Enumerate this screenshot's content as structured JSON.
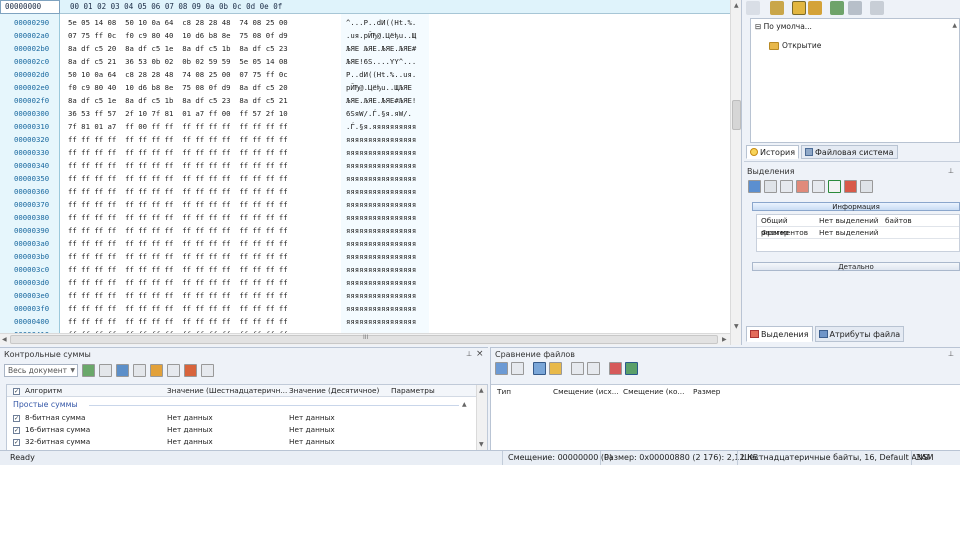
{
  "hex": {
    "offset_header": "00000000",
    "column_header": "00 01 02 03  04 05 06 07  08 09 0a 0b  0c 0d 0e 0f",
    "rows": [
      {
        "addr": "00000290",
        "bytes": "5e 05 14 08  50 10 0a 64  c8 28 28 48  74 08 25 00",
        "ascii": "^...P..dИ((Ht.%."
      },
      {
        "addr": "000002a0",
        "bytes": "07 75 ff 0c  f0 c9 80 40  10 d6 b8 8e  75 08 0f d9",
        "ascii": ".uя.рЙЂ@.Цёђu..Щ"
      },
      {
        "addr": "000002b0",
        "bytes": "8a df c5 20  8a df c5 1e  8a df c5 1b  8a df c5 23",
        "ascii": "ЉЯЕ ЉЯЕ.ЉЯЕ.ЉЯЕ#"
      },
      {
        "addr": "000002c0",
        "bytes": "8a df c5 21  36 53 0b 02  0b 02 59 59  5e 05 14 08",
        "ascii": "ЉЯЕ!6S....YY^..."
      },
      {
        "addr": "000002d0",
        "bytes": "50 10 0a 64  c8 28 28 48  74 08 25 00  07 75 ff 0c",
        "ascii": "P..dИ((Ht.%..uя."
      },
      {
        "addr": "000002e0",
        "bytes": "f0 c9 80 40  10 d6 b8 8e  75 08 0f d9  8a df c5 20",
        "ascii": "рЙЂ@.Цёђu..ЩЉЯЕ "
      },
      {
        "addr": "000002f0",
        "bytes": "8a df c5 1e  8a df c5 1b  8a df c5 23  8a df c5 21",
        "ascii": "ЉЯЕ.ЉЯЕ.ЉЯЕ#ЉЯЕ!"
      },
      {
        "addr": "00000300",
        "bytes": "36 53 ff 57  2f 10 7f 81  01 a7 ff 00  ff 57 2f 10",
        "ascii": "6SяW/.Ѓ.§я.яW/."
      },
      {
        "addr": "00000310",
        "bytes": "7f 81 01 a7  ff 00 ff ff  ff ff ff ff  ff ff ff ff",
        "ascii": ".Ѓ.§я.яяяяяяяяяя"
      },
      {
        "addr": "00000320",
        "bytes": "ff ff ff ff  ff ff ff ff  ff ff ff ff  ff ff ff ff",
        "ascii": "яяяяяяяяяяяяяяяя"
      },
      {
        "addr": "00000330",
        "bytes": "ff ff ff ff  ff ff ff ff  ff ff ff ff  ff ff ff ff",
        "ascii": "яяяяяяяяяяяяяяяя"
      },
      {
        "addr": "00000340",
        "bytes": "ff ff ff ff  ff ff ff ff  ff ff ff ff  ff ff ff ff",
        "ascii": "яяяяяяяяяяяяяяяя"
      },
      {
        "addr": "00000350",
        "bytes": "ff ff ff ff  ff ff ff ff  ff ff ff ff  ff ff ff ff",
        "ascii": "яяяяяяяяяяяяяяяя"
      },
      {
        "addr": "00000360",
        "bytes": "ff ff ff ff  ff ff ff ff  ff ff ff ff  ff ff ff ff",
        "ascii": "яяяяяяяяяяяяяяяя"
      },
      {
        "addr": "00000370",
        "bytes": "ff ff ff ff  ff ff ff ff  ff ff ff ff  ff ff ff ff",
        "ascii": "яяяяяяяяяяяяяяяя"
      },
      {
        "addr": "00000380",
        "bytes": "ff ff ff ff  ff ff ff ff  ff ff ff ff  ff ff ff ff",
        "ascii": "яяяяяяяяяяяяяяяя"
      },
      {
        "addr": "00000390",
        "bytes": "ff ff ff ff  ff ff ff ff  ff ff ff ff  ff ff ff ff",
        "ascii": "яяяяяяяяяяяяяяяя"
      },
      {
        "addr": "000003a0",
        "bytes": "ff ff ff ff  ff ff ff ff  ff ff ff ff  ff ff ff ff",
        "ascii": "яяяяяяяяяяяяяяяя"
      },
      {
        "addr": "000003b0",
        "bytes": "ff ff ff ff  ff ff ff ff  ff ff ff ff  ff ff ff ff",
        "ascii": "яяяяяяяяяяяяяяяя"
      },
      {
        "addr": "000003c0",
        "bytes": "ff ff ff ff  ff ff ff ff  ff ff ff ff  ff ff ff ff",
        "ascii": "яяяяяяяяяяяяяяяя"
      },
      {
        "addr": "000003d0",
        "bytes": "ff ff ff ff  ff ff ff ff  ff ff ff ff  ff ff ff ff",
        "ascii": "яяяяяяяяяяяяяяяя"
      },
      {
        "addr": "000003e0",
        "bytes": "ff ff ff ff  ff ff ff ff  ff ff ff ff  ff ff ff ff",
        "ascii": "яяяяяяяяяяяяяяяя"
      },
      {
        "addr": "000003f0",
        "bytes": "ff ff ff ff  ff ff ff ff  ff ff ff ff  ff ff ff ff",
        "ascii": "яяяяяяяяяяяяяяяя"
      },
      {
        "addr": "00000400",
        "bytes": "ff ff ff ff  ff ff ff ff  ff ff ff ff  ff ff ff ff",
        "ascii": "яяяяяяяяяяяяяяяя"
      },
      {
        "addr": "00000410",
        "bytes": "ff ff ff ff  ff ff ff ff  ff ff ff ff  ff ff ff ff",
        "ascii": "яяяяяяяяяяяяяяяя"
      }
    ]
  },
  "history": {
    "root_label": "По умолча...",
    "item_label": "Открытие"
  },
  "right_tabs": {
    "history": "История",
    "filesystem": "Файловая система"
  },
  "selection": {
    "title": "Выделения",
    "info_label": "Информация",
    "rows": [
      {
        "name": "Общий размер",
        "value": "Нет выделений",
        "unit": "байтов"
      },
      {
        "name": "Фрагментов",
        "value": "Нет выделений",
        "unit": ""
      }
    ],
    "detail_label": "Детально"
  },
  "bottom_right_tabs": {
    "selections": "Выделения",
    "file_attrs": "Атрибуты файла"
  },
  "checksum": {
    "title": "Контрольные суммы",
    "scope": "Весь документ",
    "columns": {
      "algorithm": "Алгоритм",
      "hex": "Значение (Шестнадцатеричн...",
      "dec": "Значение (Десятичное)",
      "params": "Параметры"
    },
    "group": "Простые суммы",
    "rows": [
      {
        "name": "8-битная сумма",
        "hex": "Нет данных",
        "dec": "Нет данных"
      },
      {
        "name": "16-битная сумма",
        "hex": "Нет данных",
        "dec": "Нет данных"
      },
      {
        "name": "32-битная сумма",
        "hex": "Нет данных",
        "dec": "Нет данных"
      }
    ]
  },
  "compare": {
    "title": "Сравнение файлов",
    "columns": {
      "type": "Тип",
      "offset_src": "Смещение (исх...",
      "offset_cmp": "Смещение (ко...",
      "size": "Размер"
    }
  },
  "status": {
    "ready": "Ready",
    "offset": "Смещение: 00000000 (0)",
    "size": "Размер: 0x00000880 (2 176): 2,12 КБ",
    "mode": "Шестнадцатеричные байты, 16, Default ANSI",
    "insert": "ЗАМ"
  },
  "scroll_marker": "III",
  "pin_icon": "pin-icon",
  "close_icon": "×"
}
